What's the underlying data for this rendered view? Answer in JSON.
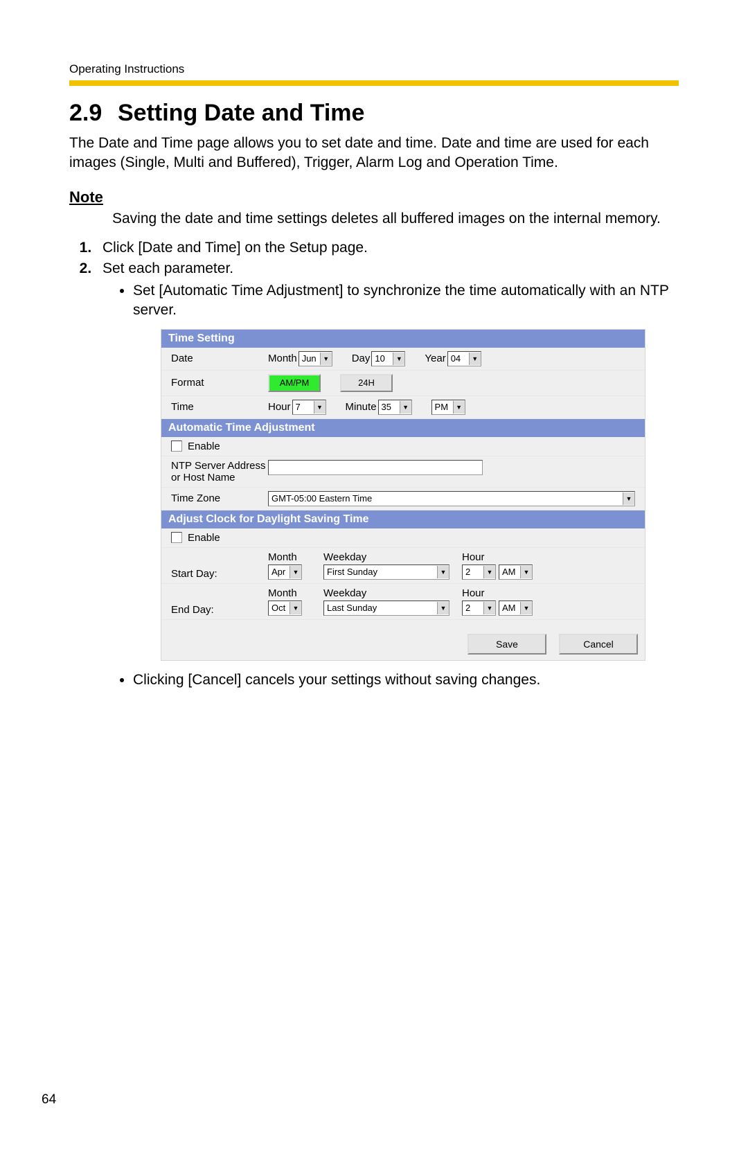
{
  "header": {
    "running": "Operating Instructions",
    "section_number": "2.9",
    "section_title": "Setting Date and Time"
  },
  "intro": "The Date and Time page allows you to set date and time. Date and time are used for each images (Single, Multi and Buffered), Trigger, Alarm Log and Operation Time.",
  "note": {
    "heading": "Note",
    "body": "Saving the date and time settings deletes all buffered images on the internal memory."
  },
  "steps": {
    "s1": "Click [Date and Time] on the Setup page.",
    "s2": "Set each parameter.",
    "s2_sub1": "Set [Automatic Time Adjustment] to synchronize the time automatically with an NTP server."
  },
  "ui": {
    "time_setting": {
      "heading": "Time Setting",
      "date": {
        "label": "Date",
        "month_label": "Month",
        "month": "Jun",
        "day_label": "Day",
        "day": "10",
        "year_label": "Year",
        "year": "04"
      },
      "format": {
        "label": "Format",
        "ampm": "AM/PM",
        "h24": "24H"
      },
      "time": {
        "label": "Time",
        "hour_label": "Hour",
        "hour": "7",
        "minute_label": "Minute",
        "minute": "35",
        "meridiem": "PM"
      }
    },
    "auto": {
      "heading": "Automatic Time Adjustment",
      "enable": "Enable",
      "ntp_label": "NTP Server Address or Host Name",
      "ntp_value": "",
      "tz_label": "Time Zone",
      "tz_value": "GMT-05:00 Eastern Time"
    },
    "dst": {
      "heading": "Adjust Clock for Daylight Saving Time",
      "enable": "Enable",
      "start_label": "Start Day:",
      "end_label": "End Day:",
      "cols": {
        "month": "Month",
        "weekday": "Weekday",
        "hour": "Hour"
      },
      "start": {
        "month": "Apr",
        "weekday": "First Sunday",
        "hour": "2",
        "ampm": "AM"
      },
      "end": {
        "month": "Oct",
        "weekday": "Last Sunday",
        "hour": "2",
        "ampm": "AM"
      }
    },
    "actions": {
      "save": "Save",
      "cancel": "Cancel"
    }
  },
  "post_bullet": "Clicking [Cancel] cancels your settings without saving changes.",
  "page_number": "64"
}
